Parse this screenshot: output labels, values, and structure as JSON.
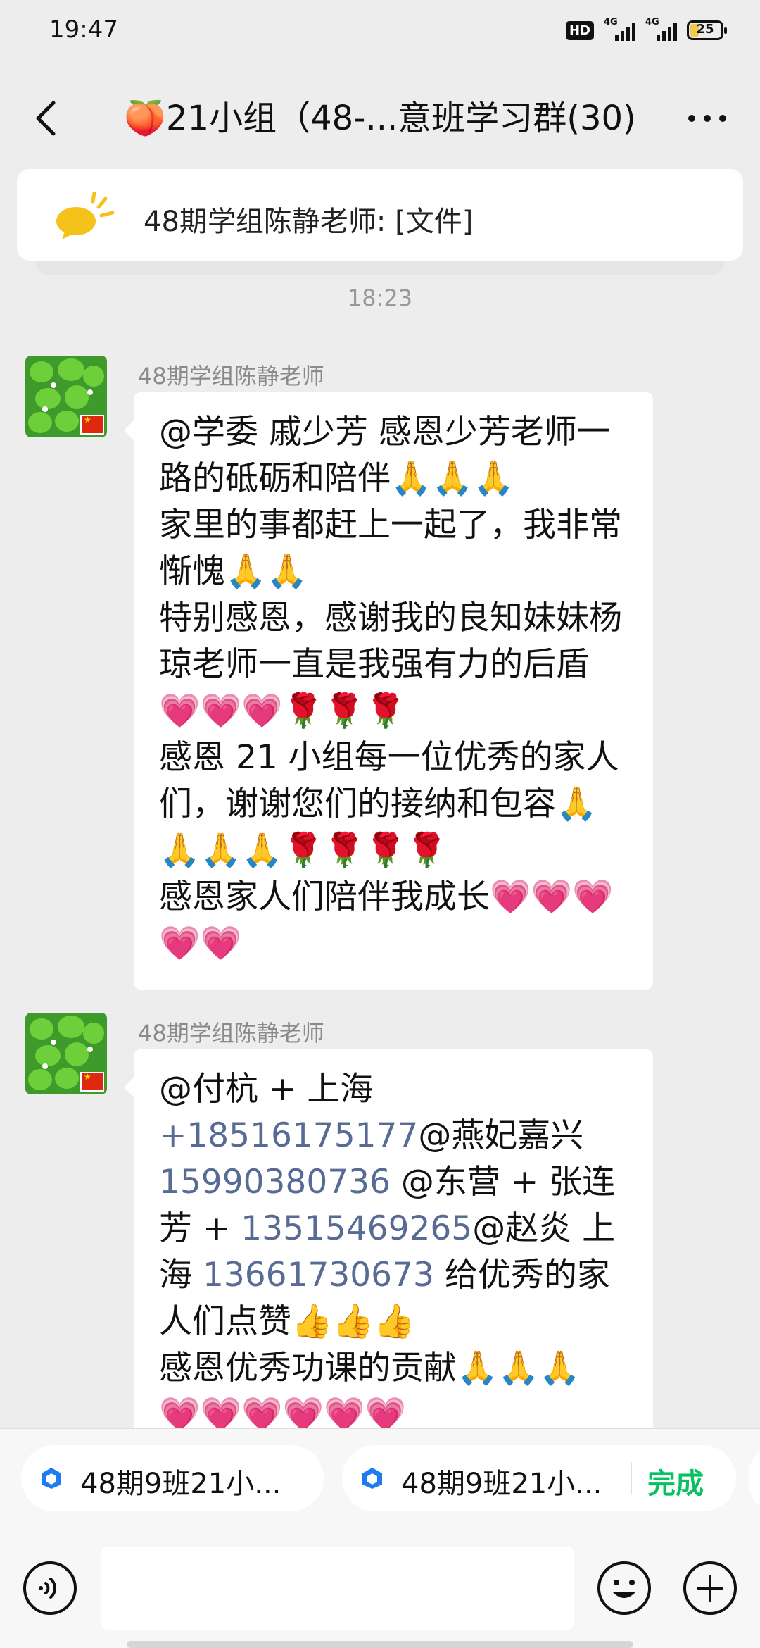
{
  "status": {
    "time": "19:47",
    "hd": "HD",
    "sim1": "4G",
    "sim2": "4G",
    "battery": "25"
  },
  "nav": {
    "title": "🍑21小组（48-...意班学习群(30)"
  },
  "pinned": {
    "text": "48期学组陈静老师: [文件]"
  },
  "timestamp": "18:23",
  "messages": [
    {
      "sender": "48期学组陈静老师",
      "lines": [
        "@学委  戚少芳   感恩少芳老师一路的砥砺和陪伴🙏🙏🙏",
        "家里的事都赶上一起了，我非常惭愧🙏🙏",
        "特别感恩，感谢我的良知妹妹杨琼老师一直是我强有力的后盾💗💗💗🌹🌹🌹",
        "感恩 21 小组每一位优秀的家人们，谢谢您们的接纳和包容🙏🙏🙏🙏🌹🌹🌹🌹",
        "感恩家人们陪伴我成长💗💗💗💗💗"
      ]
    },
    {
      "sender": "48期学组陈静老师",
      "mention1": "@付杭 + 上海 ",
      "phone1": "+18516175177",
      "mention2": "@燕妃嘉兴 ",
      "phone2": "15990380736",
      "mention3": " @东营 + 张连芳 + ",
      "phone3": "13515469265",
      "mention4": "@赵炎 上海 ",
      "phone4": "13661730673",
      "tail": "  给优秀的家人们点赞👍👍👍",
      "line2": "感恩优秀功课的贡献🙏🙏🙏",
      "line3": "💗💗💗💗💗💗"
    }
  ],
  "quick_chips": [
    {
      "label": "48期9班21小..."
    },
    {
      "label": "48期9班21小...",
      "action": "完成"
    }
  ],
  "icons": [
    "back-arrow-icon",
    "more-dots-icon",
    "announcement-speaker-icon",
    "document-icon",
    "voice-icon",
    "emoji-icon",
    "plus-icon"
  ],
  "colors": {
    "background": "#ededed",
    "bubble": "#ffffff",
    "link": "#576b95",
    "accent": "#07c160"
  }
}
